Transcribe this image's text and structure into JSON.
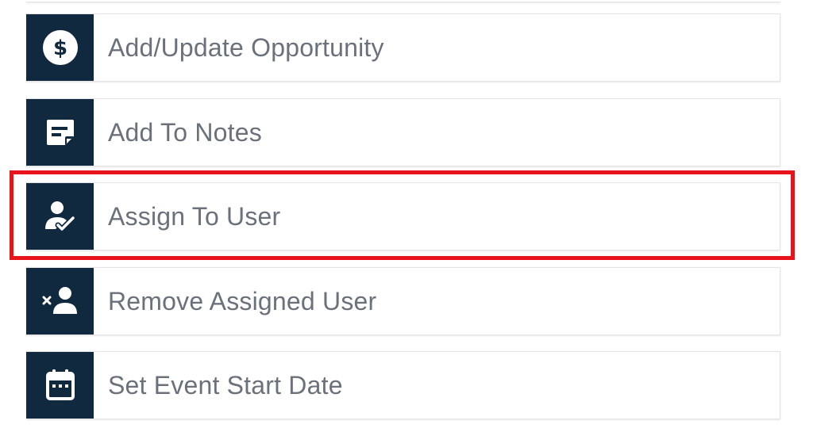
{
  "actions": {
    "items": [
      {
        "label": "Add/Update Opportunity",
        "icon": "dollar-circle-icon"
      },
      {
        "label": "Add To Notes",
        "icon": "note-icon"
      },
      {
        "label": "Assign To User",
        "icon": "user-check-icon"
      },
      {
        "label": "Remove Assigned User",
        "icon": "user-remove-icon"
      },
      {
        "label": "Set Event Start Date",
        "icon": "calendar-icon"
      }
    ]
  },
  "colors": {
    "icon_background": "#10293f",
    "label_text": "#6b717b",
    "highlight": "#e8131b"
  },
  "highlighted_item": "Assign To User"
}
